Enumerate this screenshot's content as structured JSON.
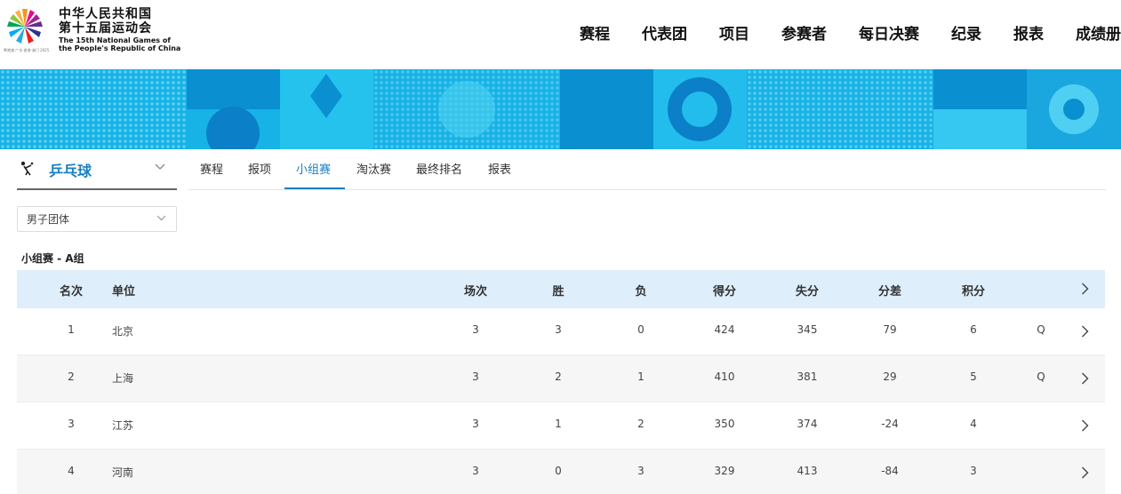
{
  "header": {
    "logo_cn_line1": "中华人民共和国",
    "logo_cn_line2": "第十五届运动会",
    "logo_en_line1": "The 15th National Games of",
    "logo_en_line2": "the People's Republic of China",
    "logo_small_text": "粤港澳 广东·香港·澳门 2025",
    "nav": [
      "赛程",
      "代表团",
      "项目",
      "参赛者",
      "每日决赛",
      "纪录",
      "报表",
      "成绩册"
    ]
  },
  "sport": {
    "name": "乒乓球",
    "icon": "table-tennis-icon"
  },
  "tabs": [
    {
      "label": "赛程",
      "active": false
    },
    {
      "label": "报项",
      "active": false
    },
    {
      "label": "小组赛",
      "active": true
    },
    {
      "label": "淘汰赛",
      "active": false
    },
    {
      "label": "最终排名",
      "active": false
    },
    {
      "label": "报表",
      "active": false
    }
  ],
  "event_select": {
    "value": "男子团体"
  },
  "group_title": "小组赛 - A组",
  "table": {
    "headers": {
      "rank": "名次",
      "unit": "单位",
      "played": "场次",
      "won": "胜",
      "lost": "负",
      "points_for": "得分",
      "points_against": "失分",
      "diff": "分差",
      "score": "积分"
    },
    "rows": [
      {
        "rank": "1",
        "unit": "北京",
        "played": "3",
        "won": "3",
        "lost": "0",
        "points_for": "424",
        "points_against": "345",
        "diff": "79",
        "score": "6",
        "q": "Q"
      },
      {
        "rank": "2",
        "unit": "上海",
        "played": "3",
        "won": "2",
        "lost": "1",
        "points_for": "410",
        "points_against": "381",
        "diff": "29",
        "score": "5",
        "q": "Q"
      },
      {
        "rank": "3",
        "unit": "江苏",
        "played": "3",
        "won": "1",
        "lost": "2",
        "points_for": "350",
        "points_against": "374",
        "diff": "-24",
        "score": "4",
        "q": ""
      },
      {
        "rank": "4",
        "unit": "河南",
        "played": "3",
        "won": "0",
        "lost": "3",
        "points_for": "329",
        "points_against": "413",
        "diff": "-84",
        "score": "3",
        "q": ""
      }
    ]
  },
  "colors": {
    "accent": "#1a7fc1",
    "banner": "#14b6e6",
    "table_header_bg": "#deeefb"
  }
}
